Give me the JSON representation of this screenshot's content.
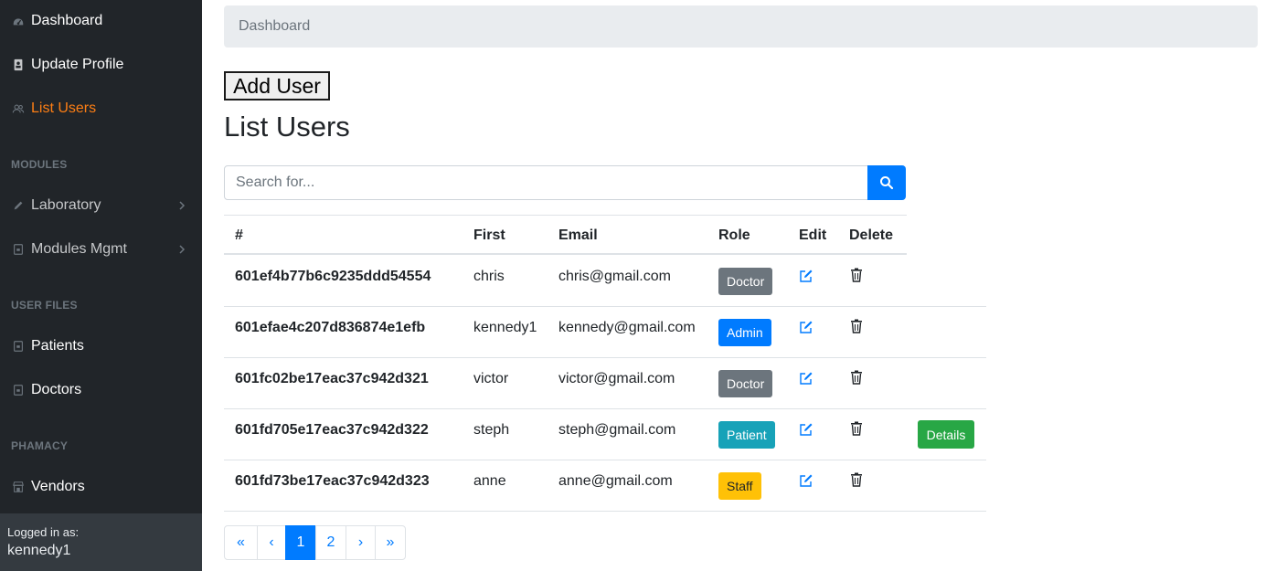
{
  "sidebar": {
    "items": [
      {
        "label": "Dashboard",
        "icon": "dashboard-icon"
      },
      {
        "label": "Update Profile",
        "icon": "profile-icon"
      },
      {
        "label": "List Users",
        "icon": "users-icon"
      },
      {
        "label": "Laboratory",
        "icon": "pencil-icon"
      },
      {
        "label": "Modules Mgmt",
        "icon": "module-icon"
      },
      {
        "label": "Patients",
        "icon": "file-icon"
      },
      {
        "label": "Doctors",
        "icon": "file-icon"
      },
      {
        "label": "Vendors",
        "icon": "store-icon"
      }
    ],
    "sections": [
      "MODULES",
      "USER FILES",
      "PHAMACY"
    ],
    "footer": {
      "label": "Logged in as:",
      "user": "kennedy1"
    }
  },
  "breadcrumb": "Dashboard",
  "add_user_label": "Add User",
  "page_title": "List Users",
  "search": {
    "placeholder": "Search for..."
  },
  "table": {
    "headers": [
      "#",
      "First",
      "Email",
      "Role",
      "Edit",
      "Delete"
    ],
    "rows": [
      {
        "id": "601ef4b77b6c9235ddd54554",
        "first": "chris",
        "email": "chris@gmail.com",
        "role": "Doctor"
      },
      {
        "id": "601efae4c207d836874e1efb",
        "first": "kennedy1",
        "email": "kennedy@gmail.com",
        "role": "Admin"
      },
      {
        "id": "601fc02be17eac37c942d321",
        "first": "victor",
        "email": "victor@gmail.com",
        "role": "Doctor"
      },
      {
        "id": "601fd705e17eac37c942d322",
        "first": "steph",
        "email": "steph@gmail.com",
        "role": "Patient",
        "details": "Details"
      },
      {
        "id": "601fd73be17eac37c942d323",
        "first": "anne",
        "email": "anne@gmail.com",
        "role": "Staff"
      }
    ]
  },
  "pagination": {
    "first": "«",
    "prev": "‹",
    "pages": [
      "1",
      "2"
    ],
    "next": "›",
    "last": "»",
    "active": "1"
  },
  "colors": {
    "sidebar_bg": "#212529",
    "accent": "#fd7e14",
    "primary": "#007bff",
    "success": "#28a745",
    "secondary": "#6c757d",
    "info": "#17a2b8",
    "warning": "#ffc107"
  }
}
